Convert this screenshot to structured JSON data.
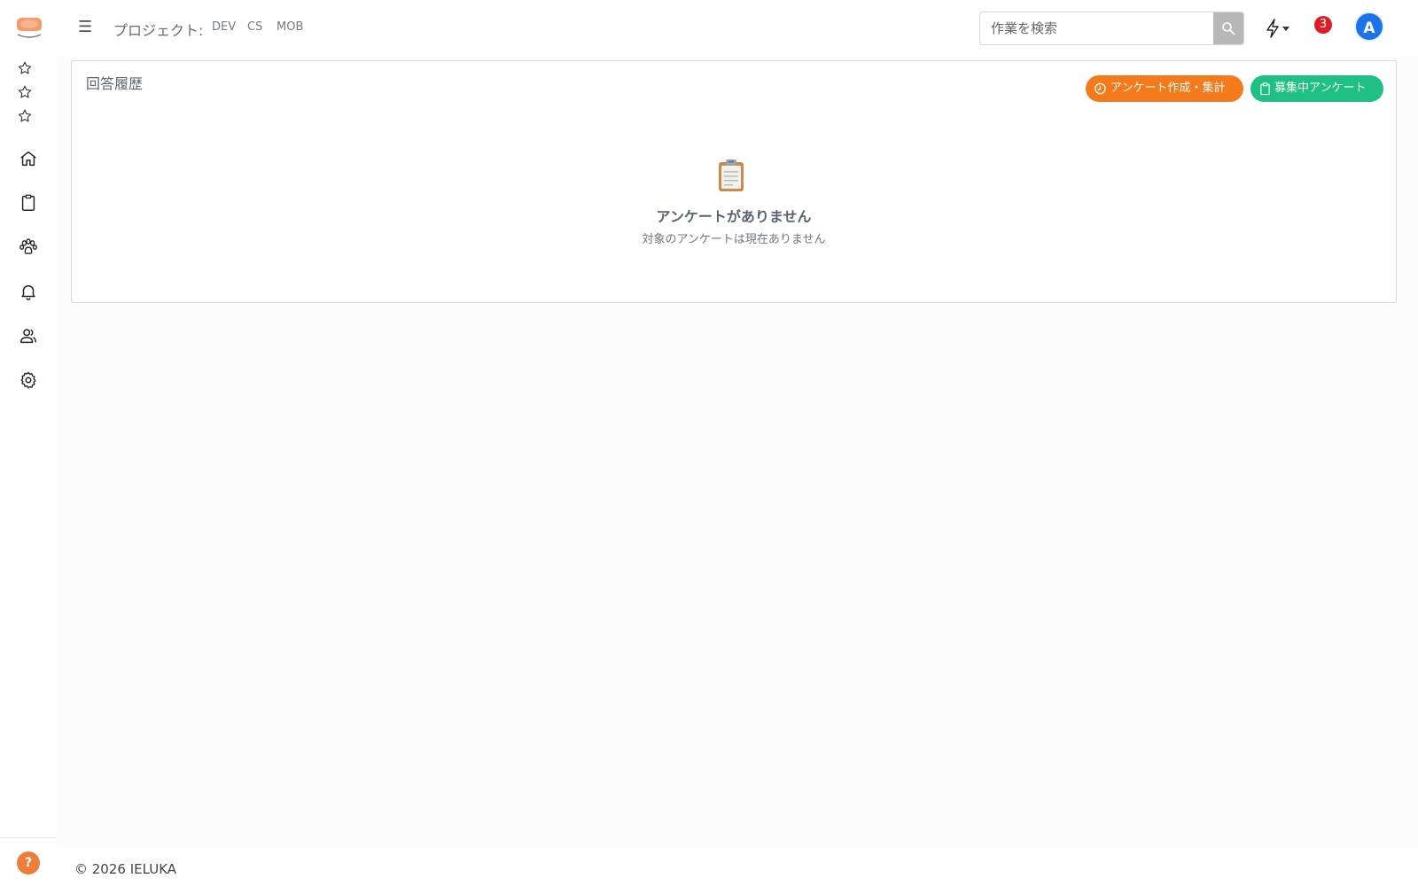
{
  "header": {
    "menu_icon": "☰",
    "project_label": "プロジェクト:",
    "projects": [
      "DEV",
      "CS",
      "MOB"
    ],
    "search": {
      "placeholder": "作業を検索"
    },
    "notification_count": "3",
    "avatar_initial": "A"
  },
  "sidebar": {
    "favorites": [
      "star-icon",
      "star-icon",
      "star-icon"
    ],
    "items": [
      "home-icon",
      "clipboard-icon",
      "paw-icon",
      "bell-icon",
      "users-icon",
      "gear-icon"
    ],
    "help_label": "?"
  },
  "card": {
    "title": "回答履歴",
    "create_button": "アンケート作成・集計",
    "recruiting_button": "募集中アンケート",
    "empty_title": "アンケートがありません",
    "empty_subtitle": "対象のアンケートは現在ありません"
  },
  "footer": {
    "copyright": "© 2026 IELUKA"
  },
  "colors": {
    "orange": "#f57a1c",
    "green": "#1ec183",
    "avatar": "#1a73e8",
    "badge": "#dc1e26",
    "help": "#ef7d3a"
  }
}
